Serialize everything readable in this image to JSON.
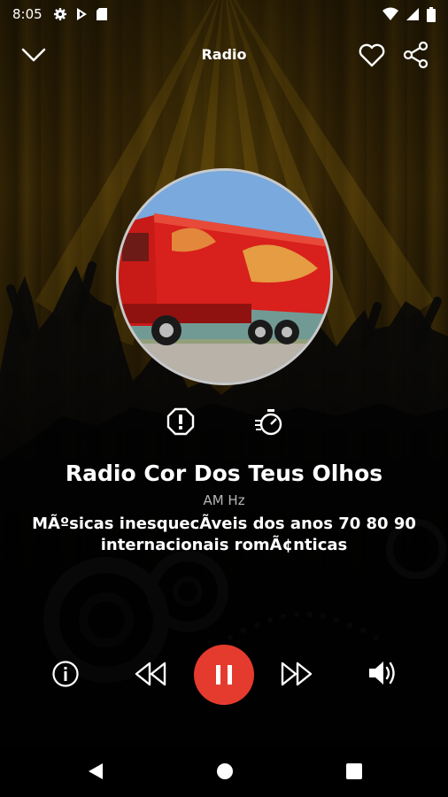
{
  "status_bar": {
    "time": "8:05",
    "left_icons": [
      "gear-icon",
      "play-store-icon",
      "sd-card-icon"
    ],
    "right_icons": [
      "wifi-icon",
      "cell-signal-icon",
      "battery-icon"
    ]
  },
  "app_bar": {
    "title": "Radio",
    "back_icon": "chevron-down-icon",
    "favorite_icon": "heart-icon",
    "share_icon": "share-icon"
  },
  "station": {
    "name": "Radio Cor Dos Teus Olhos",
    "frequency": "AM Hz",
    "description": "MÃºsicas inesquecÃveis dos anos 70 80 90 internacionais romÃ¢nticas"
  },
  "actions": {
    "report_icon": "report-icon",
    "timer_icon": "sleep-timer-icon"
  },
  "player": {
    "info_icon": "info-icon",
    "rewind_icon": "rewind-icon",
    "pause_icon": "pause-icon",
    "forward_icon": "fast-forward-icon",
    "volume_icon": "volume-icon",
    "accent_color": "#e53b2e"
  },
  "nav_bar": {
    "icons": [
      "back-triangle-icon",
      "home-circle-icon",
      "recents-square-icon"
    ]
  }
}
